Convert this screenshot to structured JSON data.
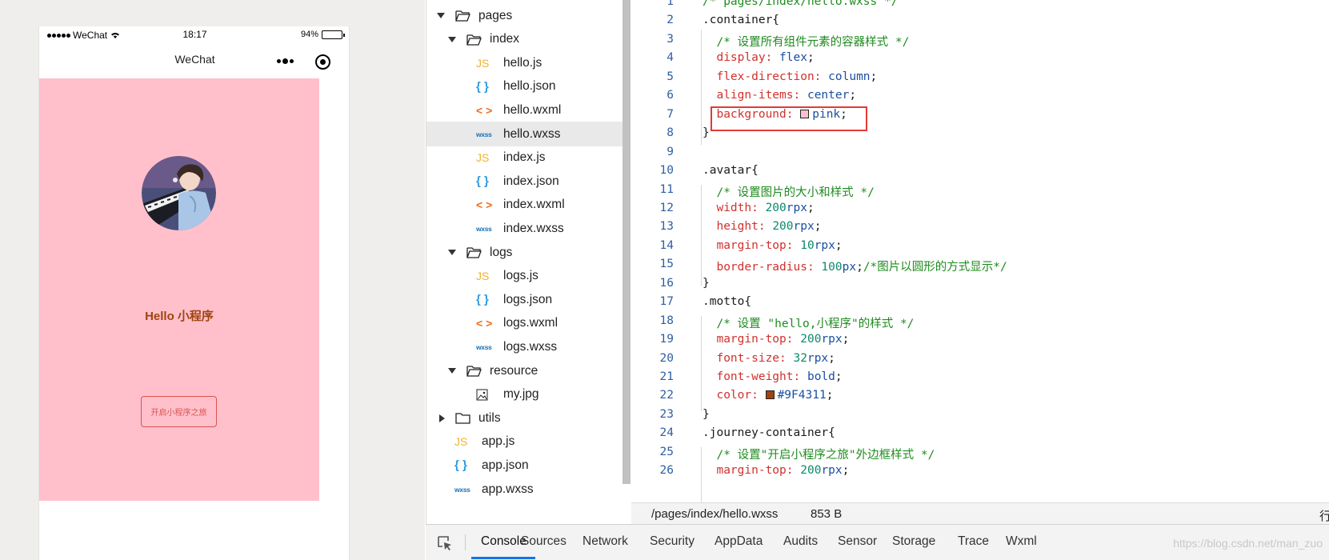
{
  "simulator": {
    "status_bar": {
      "carrier": "WeChat",
      "time": "18:17",
      "battery": "94%",
      "battery_level": 0.94
    },
    "nav_title": "WeChat",
    "page": {
      "motto": "Hello 小程序",
      "button_label": "开启小程序之旅",
      "background": "#ffc0cb",
      "motto_color": "#9F4311"
    }
  },
  "file_tree": [
    {
      "label": "pages",
      "type": "folder",
      "expanded": true
    },
    {
      "label": "index",
      "type": "folder",
      "expanded": true
    },
    {
      "label": "hello.js",
      "type": "js",
      "icon": "JS"
    },
    {
      "label": "hello.json",
      "type": "json",
      "icon": "{ }"
    },
    {
      "label": "hello.wxml",
      "type": "wxml",
      "icon": "< >"
    },
    {
      "label": "hello.wxss",
      "type": "wxss",
      "icon": "wxss",
      "active": true
    },
    {
      "label": "index.js",
      "type": "js",
      "icon": "JS"
    },
    {
      "label": "index.json",
      "type": "json",
      "icon": "{ }"
    },
    {
      "label": "index.wxml",
      "type": "wxml",
      "icon": "< >"
    },
    {
      "label": "index.wxss",
      "type": "wxss",
      "icon": "wxss"
    },
    {
      "label": "logs",
      "type": "folder",
      "expanded": true
    },
    {
      "label": "logs.js",
      "type": "js",
      "icon": "JS"
    },
    {
      "label": "logs.json",
      "type": "json",
      "icon": "{ }"
    },
    {
      "label": "logs.wxml",
      "type": "wxml",
      "icon": "< >"
    },
    {
      "label": "logs.wxss",
      "type": "wxss",
      "icon": "wxss"
    },
    {
      "label": "resource",
      "type": "folder",
      "expanded": true
    },
    {
      "label": "my.jpg",
      "type": "image"
    },
    {
      "label": "utils",
      "type": "folder",
      "expanded": false
    },
    {
      "label": "app.js",
      "type": "js",
      "icon": "JS"
    },
    {
      "label": "app.json",
      "type": "json",
      "icon": "{ }"
    },
    {
      "label": "app.wxss",
      "type": "wxss",
      "icon": "wxss"
    }
  ],
  "editor": {
    "lines": [
      "/* pages/index/hello.wxss */",
      ".container{",
      "  /* 设置所有组件元素的容器样式 */",
      "  display: flex;",
      "  flex-direction: column;",
      "  align-items: center;",
      "  background: pink;",
      "}",
      "",
      ".avatar{",
      "  /* 设置图片的大小和样式 */",
      "  width: 200rpx;",
      "  height: 200rpx;",
      "  margin-top: 10rpx;",
      "  border-radius: 100px;/*图片以圆形的方式显示*/",
      "}",
      ".motto{",
      "  /* 设置 \"hello,小程序\"的样式 */",
      "  margin-top: 200rpx;",
      "  font-size: 32rpx;",
      "  font-weight: bold;",
      "  color: #9F4311;",
      "}",
      ".journey-container{",
      "  /* 设置\"开启小程序之旅\"外边框样式 */",
      "  margin-top: 200rpx;"
    ],
    "swatch_colors": {
      "7": "#ffc0cb",
      "22": "#9F4311"
    },
    "highlighted_line": 7,
    "status": {
      "path": "/pages/index/hello.wxss",
      "size": "853 B",
      "right_label": "行"
    }
  },
  "devtools": {
    "tabs": [
      "Console",
      "Sources",
      "Network",
      "Security",
      "AppData",
      "Audits",
      "Sensor",
      "Storage",
      "Trace",
      "Wxml"
    ],
    "active_tab": "Console",
    "watermark": "https://blog.csdn.net/man_zuo"
  }
}
